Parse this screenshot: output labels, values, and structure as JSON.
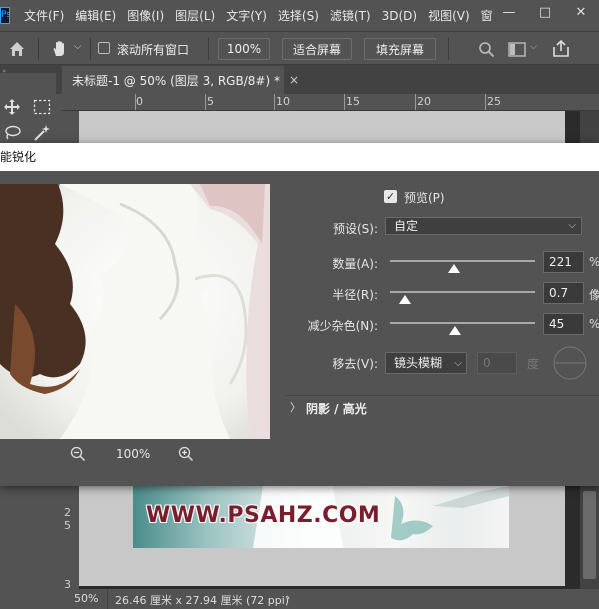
{
  "app": {
    "logo": "Ps"
  },
  "menu": [
    "文件(F)",
    "编辑(E)",
    "图像(I)",
    "图层(L)",
    "文字(Y)",
    "选择(S)",
    "滤镜(T)",
    "3D(D)",
    "视图(V)",
    "窗"
  ],
  "window_buttons": {
    "minimize": "—",
    "maximize": "□",
    "close": "✕"
  },
  "options": {
    "scroll_all_label": "滚动所有窗口",
    "zoom_value": "100%",
    "fit_screen": "适合屏幕",
    "fill_screen": "填充屏幕"
  },
  "document": {
    "tab_title": "未标题-1 @ 50% (图层 3, RGB/8#) *",
    "tab_close": "×",
    "ruler_labels": [
      "0",
      "5",
      "10",
      "15",
      "20",
      "25"
    ],
    "vruler_labels": [
      "2",
      "5",
      "3"
    ],
    "banner_text": "WWW.PSAHZ.COM"
  },
  "dialog": {
    "title": "智能锐化",
    "title_visible": "能锐化",
    "preview_label": "预览(P)",
    "preview_checked": true,
    "preset_label": "预设(S):",
    "preset_value": "自定",
    "amount_label": "数量(A):",
    "amount_value": "221",
    "amount_unit": "%",
    "amount_level": 0.442,
    "radius_label": "半径(R):",
    "radius_value": "0.7",
    "radius_unit": "像",
    "radius_level": 0.1,
    "noise_label": "减少杂色(N):",
    "noise_value": "45",
    "noise_unit": "%",
    "noise_level": 0.45,
    "remove_label": "移去(V):",
    "remove_value": "镜头模糊",
    "angle_value": "0",
    "angle_unit": "度",
    "shadow_section": "阴影 / 高光",
    "zoom_value": "100%"
  },
  "status": {
    "zoom": "50%",
    "doc_size": "26.46 厘米 x 27.94 厘米 (72 ppi)"
  }
}
